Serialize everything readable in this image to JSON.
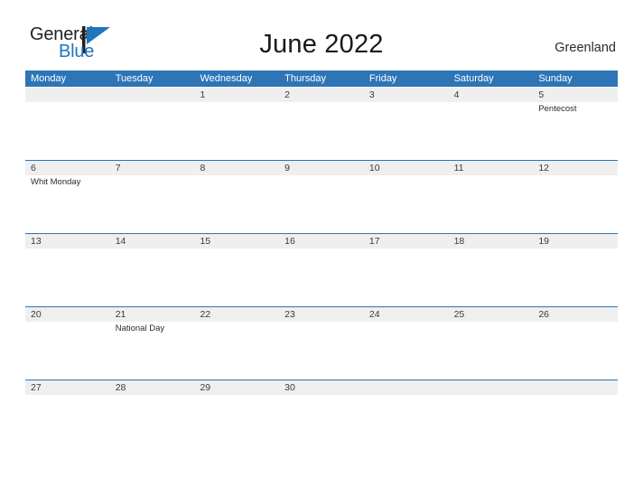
{
  "brand": {
    "line1": "General",
    "line2": "Blue",
    "flag_icon": "blue-triangle-flag",
    "accent_dark": "#231f20",
    "accent_blue": "#1f76bc"
  },
  "header": {
    "title": "June 2022",
    "region": "Greenland"
  },
  "theme": {
    "header_blue": "#2e75b6",
    "date_band_gray": "#efefef",
    "page_background": "#ffffff"
  },
  "calendar": {
    "weekdays": [
      "Monday",
      "Tuesday",
      "Wednesday",
      "Thursday",
      "Friday",
      "Saturday",
      "Sunday"
    ],
    "weeks": [
      {
        "days": [
          {
            "date": "",
            "events": []
          },
          {
            "date": "",
            "events": []
          },
          {
            "date": "1",
            "events": []
          },
          {
            "date": "2",
            "events": []
          },
          {
            "date": "3",
            "events": []
          },
          {
            "date": "4",
            "events": []
          },
          {
            "date": "5",
            "events": [
              "Pentecost"
            ]
          }
        ]
      },
      {
        "days": [
          {
            "date": "6",
            "events": [
              "Whit Monday"
            ]
          },
          {
            "date": "7",
            "events": []
          },
          {
            "date": "8",
            "events": []
          },
          {
            "date": "9",
            "events": []
          },
          {
            "date": "10",
            "events": []
          },
          {
            "date": "11",
            "events": []
          },
          {
            "date": "12",
            "events": []
          }
        ]
      },
      {
        "days": [
          {
            "date": "13",
            "events": []
          },
          {
            "date": "14",
            "events": []
          },
          {
            "date": "15",
            "events": []
          },
          {
            "date": "16",
            "events": []
          },
          {
            "date": "17",
            "events": []
          },
          {
            "date": "18",
            "events": []
          },
          {
            "date": "19",
            "events": []
          }
        ]
      },
      {
        "days": [
          {
            "date": "20",
            "events": []
          },
          {
            "date": "21",
            "events": [
              "National Day"
            ]
          },
          {
            "date": "22",
            "events": []
          },
          {
            "date": "23",
            "events": []
          },
          {
            "date": "24",
            "events": []
          },
          {
            "date": "25",
            "events": []
          },
          {
            "date": "26",
            "events": []
          }
        ]
      },
      {
        "days": [
          {
            "date": "27",
            "events": []
          },
          {
            "date": "28",
            "events": []
          },
          {
            "date": "29",
            "events": []
          },
          {
            "date": "30",
            "events": []
          },
          {
            "date": "",
            "events": []
          },
          {
            "date": "",
            "events": []
          },
          {
            "date": "",
            "events": []
          }
        ]
      }
    ]
  }
}
